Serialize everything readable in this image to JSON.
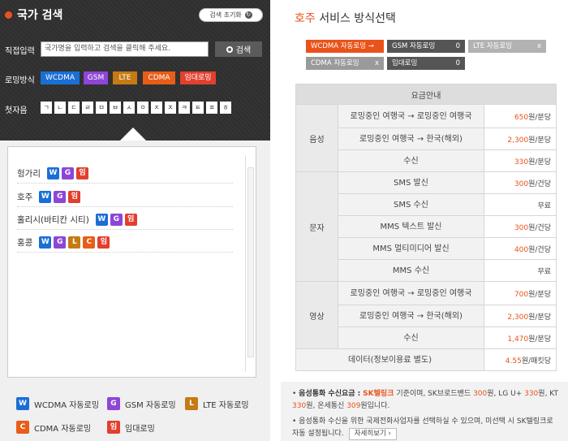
{
  "search": {
    "title": "국가 검색",
    "reset": "검색 초기화",
    "reset_icon": "↻",
    "direct_label": "직접입력",
    "placeholder": "국가명을 입력하고 검색을 클릭해 주세요.",
    "search_btn": "검색",
    "roaming_label": "로밍방식",
    "tags": [
      "WCDMA",
      "GSM",
      "LTE",
      "CDMA",
      "임대로밍"
    ],
    "initial_label": "첫자음",
    "initials": [
      "ㄱ",
      "ㄴ",
      "ㄷ",
      "ㄹ",
      "ㅁ",
      "ㅂ",
      "ㅅ",
      "ㅇ",
      "ㅈ",
      "ㅊ",
      "ㅋ",
      "ㅌ",
      "ㅍ",
      "ㅎ"
    ]
  },
  "countries": [
    {
      "name": "헝가리",
      "badges": [
        "W",
        "G",
        "임"
      ]
    },
    {
      "name": "호주",
      "badges": [
        "W",
        "G",
        "임"
      ]
    },
    {
      "name": "홀리시(바티칸 시티)",
      "badges": [
        "W",
        "G",
        "임"
      ]
    },
    {
      "name": "홍콩",
      "badges": [
        "W",
        "G",
        "L",
        "C",
        "임"
      ]
    }
  ],
  "legend": [
    {
      "b": "W",
      "t": "WCDMA 자동로밍"
    },
    {
      "b": "G",
      "t": "GSM 자동로밍"
    },
    {
      "b": "L",
      "t": "LTE 자동로밍"
    },
    {
      "b": "C",
      "t": "CDMA 자동로밍"
    },
    {
      "b": "임",
      "t": "임대로밍"
    }
  ],
  "detail": {
    "country": "호주",
    "title_suffix": "서비스 방식선택",
    "pills": [
      {
        "label": "WCDMA 자동로밍 →",
        "mark": ""
      },
      {
        "label": "GSM 자동로밍",
        "mark": "0"
      },
      {
        "label": "LTE 자동로밍",
        "mark": "x"
      },
      {
        "label": "CDMA 자동로밍",
        "mark": "x"
      },
      {
        "label": "임대로밍",
        "mark": "0"
      }
    ],
    "table_header": "요금안내",
    "cats": {
      "voice": "음성",
      "text": "문자",
      "video": "영상"
    },
    "rows": {
      "v1": {
        "d": "로밍중인 여행국 → 로밍중인 여행국",
        "n": "650",
        "u": "원/분당"
      },
      "v2": {
        "d": "로밍중인 여행국 → 한국(해외)",
        "n": "2,300",
        "u": "원/분당"
      },
      "v3": {
        "d": "수신",
        "n": "330",
        "u": "원/분당"
      },
      "t1": {
        "d": "SMS 발신",
        "n": "300",
        "u": "원/건당"
      },
      "t2": {
        "d": "SMS 수신",
        "n": "",
        "u": "무료"
      },
      "t3": {
        "d": "MMS 텍스트 발신",
        "n": "300",
        "u": "원/건당"
      },
      "t4": {
        "d": "MMS 멀티미디어 발신",
        "n": "400",
        "u": "원/건당"
      },
      "t5": {
        "d": "MMS 수신",
        "n": "",
        "u": "무료"
      },
      "m1": {
        "d": "로밍중인 여행국 → 로밍중인 여행국",
        "n": "700",
        "u": "원/분당"
      },
      "m2": {
        "d": "로밍중인 여행국 → 한국(해외)",
        "n": "2,300",
        "u": "원/분당"
      },
      "m3": {
        "d": "수신",
        "n": "1,470",
        "u": "원/분당"
      },
      "data": {
        "d": "데이터(정보이용료 별도)",
        "n": "4.55",
        "u": "원/패킷당"
      }
    }
  },
  "notes": {
    "n1_bold": "음성통화 수신요금 :",
    "n1_orange": "SK텔링크",
    "n1_a": "기준이며, SK브로드밴드",
    "n1_b": "300",
    "n1_c": "원, LG U+",
    "n1_d": "330",
    "n1_e": "원, KT",
    "n1_f": "330",
    "n1_g": "원, 온세통신",
    "n1_h": "309",
    "n1_i": "원입니다.",
    "n2": "음성통화 수신을 위한 국제전화사업자를 선택하실 수 있으며, 미선택 시 SK텔링크로 자동 설정됩니다.",
    "more": "자세히보기 ›"
  },
  "colors": {
    "W": "#1a6fd6",
    "G": "#8d46d6",
    "L": "#c57a14",
    "C": "#e85d17",
    "I": "#e23f2d",
    "accent": "#e9531b"
  }
}
